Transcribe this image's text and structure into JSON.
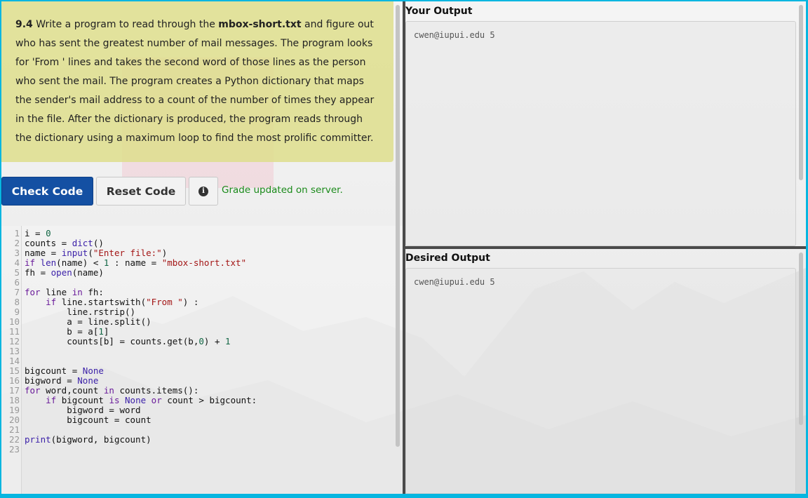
{
  "problem": {
    "number": "9.4",
    "text_before": " Write a program to read through the ",
    "filename": "mbox-short.txt",
    "text_after": " and figure out who has sent the greatest number of mail messages. The program looks for 'From ' lines and takes the second word of those lines as the person who sent the mail. The program creates a Python dictionary that maps the sender's mail address to a count of the number of times they appear in the file. After the dictionary is produced, the program reads through the dictionary using a maximum loop to find the most prolific committer."
  },
  "toolbar": {
    "check_label": "Check Code",
    "reset_label": "Reset Code",
    "info_icon": "info-icon",
    "status": "Grade updated on server."
  },
  "editor": {
    "lines": [
      "i = 0",
      "counts = dict()",
      "name = input(\"Enter file:\")",
      "if len(name) < 1 : name = \"mbox-short.txt\"",
      "fh = open(name)",
      "",
      "for line in fh:",
      "    if line.startswith(\"From \") :",
      "        line.rstrip()",
      "        a = line.split()",
      "        b = a[1]",
      "        counts[b] = counts.get(b,0) + 1",
      "",
      "",
      "bigcount = None",
      "bigword = None",
      "for word,count in counts.items():",
      "    if bigcount is None or count > bigcount:",
      "        bigword = word",
      "        bigcount = count",
      "",
      "print(bigword, bigcount)",
      ""
    ]
  },
  "your_output": {
    "title": "Your Output",
    "text": "cwen@iupui.edu 5"
  },
  "desired_output": {
    "title": "Desired Output",
    "text": "cwen@iupui.edu 5"
  },
  "colors": {
    "frame_border": "#06b6e0",
    "check_button": "#1450a3",
    "status_text": "#1a8a1a",
    "problem_bg": "#dede8c"
  }
}
